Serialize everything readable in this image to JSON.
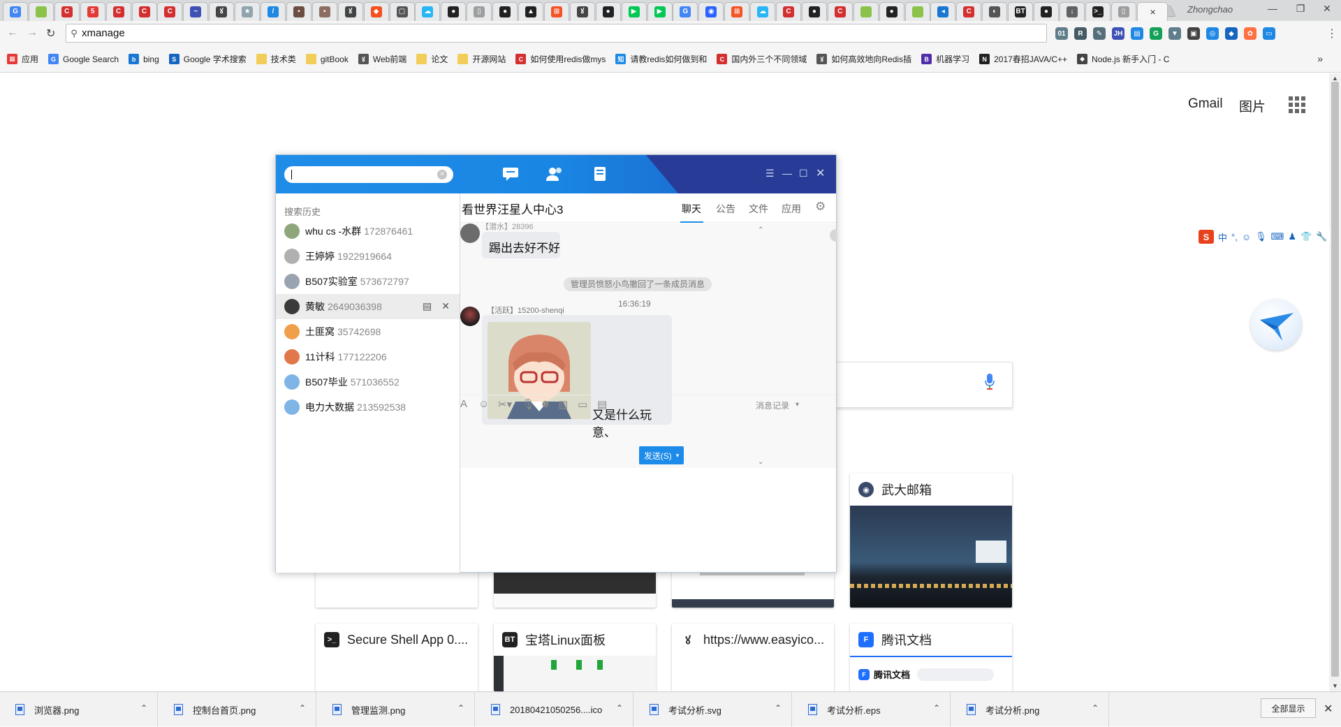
{
  "browser": {
    "profile_name": "Zhongchao",
    "address": "xmanage",
    "active_tab_close": "×",
    "window_controls": {
      "minimize": "—",
      "restore": "❐",
      "close": "✕"
    },
    "tabs": [
      {
        "icon": "google-icon",
        "glyph": "G",
        "color": "#4285f4"
      },
      {
        "icon": "green-square-icon",
        "glyph": "",
        "color": "#8bc34a"
      },
      {
        "icon": "csdn-icon",
        "glyph": "C",
        "color": "#d32f2f"
      },
      {
        "icon": "dots-icon",
        "glyph": "5",
        "color": "#e53935"
      },
      {
        "icon": "csdn-icon",
        "glyph": "C",
        "color": "#d32f2f"
      },
      {
        "icon": "csdn-icon",
        "glyph": "C",
        "color": "#d32f2f"
      },
      {
        "icon": "csdn-icon",
        "glyph": "C",
        "color": "#d32f2f"
      },
      {
        "icon": "chart-icon",
        "glyph": "~",
        "color": "#3f51b5"
      },
      {
        "icon": "figure-icon",
        "glyph": "ꙋ",
        "color": "#444444"
      },
      {
        "icon": "star-icon",
        "glyph": "★",
        "color": "#90a4ae"
      },
      {
        "icon": "edit-icon",
        "glyph": "/",
        "color": "#1e88e5"
      },
      {
        "icon": "photo-icon",
        "glyph": "▪",
        "color": "#6d4c41"
      },
      {
        "icon": "photo-icon",
        "glyph": "▪",
        "color": "#8d6e63"
      },
      {
        "icon": "figure-icon",
        "glyph": "ꙋ",
        "color": "#444444"
      },
      {
        "icon": "orange-app-icon",
        "glyph": "◆",
        "color": "#f4511e"
      },
      {
        "icon": "window-icon",
        "glyph": "▢",
        "color": "#555555"
      },
      {
        "icon": "cloud-icon",
        "glyph": "☁",
        "color": "#29b6f6"
      },
      {
        "icon": "github-icon",
        "glyph": "●",
        "color": "#222222"
      },
      {
        "icon": "doc-icon",
        "glyph": "▯",
        "color": "#9e9e9e"
      },
      {
        "icon": "github-icon",
        "glyph": "●",
        "color": "#222222"
      },
      {
        "icon": "tri-icon",
        "glyph": "▲",
        "color": "#212121"
      },
      {
        "icon": "windows-icon",
        "glyph": "⊞",
        "color": "#f35325"
      },
      {
        "icon": "figure-icon",
        "glyph": "ꙋ",
        "color": "#444444"
      },
      {
        "icon": "github-icon",
        "glyph": "●",
        "color": "#222222"
      },
      {
        "icon": "play-icon",
        "glyph": "▶",
        "color": "#00c853"
      },
      {
        "icon": "play-icon",
        "glyph": "▶",
        "color": "#00c853"
      },
      {
        "icon": "google-icon",
        "glyph": "G",
        "color": "#4285f4"
      },
      {
        "icon": "baidu-icon",
        "glyph": "◉",
        "color": "#2962ff"
      },
      {
        "icon": "windows-icon",
        "glyph": "⊞",
        "color": "#f35325"
      },
      {
        "icon": "cloud-icon",
        "glyph": "☁",
        "color": "#29b6f6"
      },
      {
        "icon": "csdn-icon",
        "glyph": "C",
        "color": "#d32f2f"
      },
      {
        "icon": "github-icon",
        "glyph": "●",
        "color": "#222222"
      },
      {
        "icon": "csdn-icon",
        "glyph": "C",
        "color": "#d32f2f"
      },
      {
        "icon": "green-square-icon",
        "glyph": "",
        "color": "#8bc34a"
      },
      {
        "icon": "github-icon",
        "glyph": "●",
        "color": "#222222"
      },
      {
        "icon": "green-square-icon",
        "glyph": "",
        "color": "#8bc34a"
      },
      {
        "icon": "blue-app-icon",
        "glyph": "◂",
        "color": "#1976d2"
      },
      {
        "icon": "csdn-icon",
        "glyph": "C",
        "color": "#d32f2f"
      },
      {
        "icon": "shell-icon",
        "glyph": "◐",
        "color": "#555555"
      },
      {
        "icon": "bt-icon",
        "glyph": "BT",
        "color": "#222222"
      },
      {
        "icon": "github-icon",
        "glyph": "●",
        "color": "#222222"
      },
      {
        "icon": "download-icon",
        "glyph": "↓",
        "color": "#616161"
      },
      {
        "icon": "terminal-icon",
        "glyph": ">_",
        "color": "#212121"
      },
      {
        "icon": "doc-icon",
        "glyph": "▯",
        "color": "#9e9e9e"
      }
    ],
    "extensions": [
      {
        "icon": "rss-ext-icon",
        "glyph": "01",
        "color": "#607d8b"
      },
      {
        "icon": "r-ext-icon",
        "glyph": "R",
        "color": "#455a64"
      },
      {
        "icon": "evernote-ext-icon",
        "glyph": "✎",
        "color": "#546e7a"
      },
      {
        "icon": "jh-ext-icon",
        "glyph": "JH",
        "color": "#3f51b5"
      },
      {
        "icon": "note-ext-icon",
        "glyph": "▤",
        "color": "#1e88e5"
      },
      {
        "icon": "grammarly-ext-icon",
        "glyph": "G",
        "color": "#15a05a"
      },
      {
        "icon": "vue-ext-icon",
        "glyph": "▼",
        "color": "#607d8b"
      },
      {
        "icon": "tab-ext-icon",
        "glyph": "▣",
        "color": "#424242"
      },
      {
        "icon": "proxy-ext-icon",
        "glyph": "◎",
        "color": "#1e88e5"
      },
      {
        "icon": "graduate-ext-icon",
        "glyph": "◆",
        "color": "#1565c0"
      },
      {
        "icon": "orange-ext-icon",
        "glyph": "✿",
        "color": "#ff7043"
      },
      {
        "icon": "screen-ext-icon",
        "glyph": "▭",
        "color": "#1e88e5"
      }
    ],
    "bookmarks": [
      {
        "label": "应用",
        "icon": "apps-grid-icon",
        "glyph": "▦",
        "color": "#e53935"
      },
      {
        "label": "Google Search",
        "icon": "google-icon",
        "glyph": "G",
        "color": "#4285f4"
      },
      {
        "label": "bing",
        "icon": "bing-icon",
        "glyph": "b",
        "color": "#1976d2"
      },
      {
        "label": "Google 学术搜索",
        "icon": "scholar-icon",
        "glyph": "S",
        "color": "#1565c0"
      },
      {
        "label": "技术类",
        "icon": "folder-icon",
        "glyph": "",
        "color": "#f3cd59"
      },
      {
        "label": "gitBook",
        "icon": "folder-icon",
        "glyph": "",
        "color": "#f3cd59"
      },
      {
        "label": "Web前端",
        "icon": "figure-icon",
        "glyph": "ꙋ",
        "color": "#555555"
      },
      {
        "label": "论文",
        "icon": "folder-icon",
        "glyph": "",
        "color": "#f3cd59"
      },
      {
        "label": "开源网站",
        "icon": "folder-icon",
        "glyph": "",
        "color": "#f3cd59"
      },
      {
        "label": "如何使用redis做mys",
        "icon": "csdn-icon",
        "glyph": "C",
        "color": "#d32f2f"
      },
      {
        "label": "请教redis如何做到和",
        "icon": "zhihu-icon",
        "glyph": "知",
        "color": "#1e88e5"
      },
      {
        "label": "国内外三个不同领域",
        "icon": "csdn-icon",
        "glyph": "C",
        "color": "#d32f2f"
      },
      {
        "label": "如何高效地向Redis插",
        "icon": "figure-icon",
        "glyph": "ꙋ",
        "color": "#555555"
      },
      {
        "label": "机器学习",
        "icon": "b-icon",
        "glyph": "B",
        "color": "#512da8"
      },
      {
        "label": "2017春招JAVA/C++",
        "icon": "nowcoder-icon",
        "glyph": "N",
        "color": "#212121"
      },
      {
        "label": "Node.js 新手入门 - C",
        "icon": "cnode-icon",
        "glyph": "◆",
        "color": "#444444"
      }
    ]
  },
  "newtab": {
    "gmail": "Gmail",
    "images": "图片",
    "tiles_row1": [
      {
        "title": "武大邮箱",
        "icon": "whu-mail-icon",
        "glyph": "◉",
        "color": "#3b4a6b"
      }
    ],
    "tiles_row2": [
      {
        "title": "Secure Shell App 0....",
        "icon": "terminal-icon",
        "glyph": ">_",
        "color": "#212121"
      },
      {
        "title": "宝塔Linux面板",
        "icon": "bt-icon",
        "glyph": "BT",
        "color": "#222222"
      },
      {
        "title": "https://www.easyico...",
        "icon": "figure-icon",
        "glyph": "ꙋ",
        "color": "#333333"
      },
      {
        "title": "腾讯文档",
        "icon": "tencent-docs-icon",
        "glyph": "F",
        "color": "#1e6fff"
      }
    ],
    "tencent_docs_preview_label": "腾讯文档"
  },
  "qq": {
    "search_value": "",
    "history_title": "搜索历史",
    "history": [
      {
        "name": "whu cs -水群",
        "number": "172876461",
        "color": "#8fa67a"
      },
      {
        "name": "王婷婷",
        "number": "1922919664",
        "color": "#b0b0b0"
      },
      {
        "name": "B507实验室",
        "number": "573672797",
        "color": "#9aa4b0"
      },
      {
        "name": "黄敏",
        "number": "2649036398",
        "color": "#3a3a3a"
      },
      {
        "name": "土匪窝",
        "number": "35742698",
        "color": "#f0a04b"
      },
      {
        "name": "11计科",
        "number": "177122206",
        "color": "#e0784c"
      },
      {
        "name": "B507毕业",
        "number": "571036552",
        "color": "#7fb4e6"
      },
      {
        "name": "电力大数据",
        "number": "213592538",
        "color": "#7fb4e6"
      }
    ],
    "group_title": "看世界汪星人中心3",
    "tabs": [
      "聊天",
      "公告",
      "文件",
      "应用"
    ],
    "messages": {
      "sender1_meta": "【潜水】28396",
      "msg1": "踢出去好不好",
      "system_note": "管理员愤怒小鸟撤回了一条成员消息",
      "timestamp": "16:36:19",
      "sender2_meta": "【活跃】15200-shenqi",
      "msg2_text": "又是什么玩意、"
    },
    "history_link": "消息记录",
    "send_label": "发送(S)"
  },
  "downloads": {
    "items": [
      "浏览器.png",
      "控制台首页.png",
      "管理监测.png",
      "20180421050256....ico",
      "考试分析.svg",
      "考试分析.eps",
      "考试分析.png"
    ],
    "show_all": "全部显示"
  },
  "colors": {
    "qq_blue": "#1a86e3",
    "qq_dark": "#273b97",
    "send_blue": "#1c8bea"
  }
}
